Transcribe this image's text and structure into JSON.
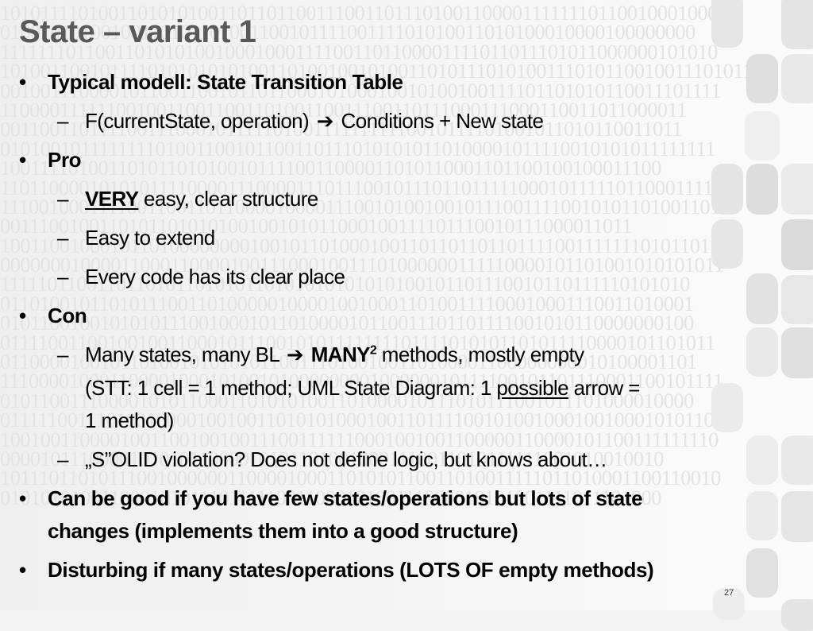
{
  "slide": {
    "title": "State – variant 1",
    "page_number": "27",
    "background_binary": [
      "1010111101001101010100110110110011100110111010011000011111110110010001000",
      "0100101010010011010110100110010111100111101010011010100010000100000000",
      "1111111011001101010100100010001111001101100001111011011101011000000101010",
      "1010011001011110101010101001101001001010011010111010100111010110010011101011",
      "0010011100001011001100101101100010100010010100100111101101010110011101111",
      "1100001111110010011001100110100110011100110111000111000110011011000011",
      "0011001101111001110001011111010011111111110010111101001011010110011011",
      "0101001011111111010011001011001101110101010110100001011110010101011111111",
      "1001111010011010110101001011110011000011010110001101100100100011100",
      "1101100001010101111000011100001110111001011101101111100010111110110001111",
      "1110010001111001100110110000100001110010100100101110011110010101101001101",
      "0011100100110101101010100100101011000100111101110010111000011011",
      "1001100100010110100000000100101101000100110110110110111100111111101011011",
      "0000000100001100011000010011100010011101000000111110000101101001010101011",
      "1111101100110110101101010110101010101010100101101110010110111110101010",
      "0110100101101011100110100000100001001000110100111100010001110011010001",
      "0101100100101010111001000101101000010110011101101111001010110000000100",
      "0111100110010010011000101110010101111111101111010101101011110000101101011",
      "0110000100101101001010101011001110100100110100001100000000010100001101",
      "1110000100011000010001010010100000000100000010111100101101110001100101111",
      "0101100111000010101100011010101001101000010111010111001011101000010000",
      "0111110011101001000010010011010101000100110111100101001000100100010101101",
      "1001001100001001100100100111001111110001001001100000110000101100111111110",
      "0000101110000101010110000101011010010001110011010111111001010010010",
      "1011101101011100100000011000010001101010110011010011111011010001100110010",
      "0101010100110001010111011111001100010100111000010101001111011101000"
    ]
  },
  "bullets": [
    {
      "level": 1,
      "text": "Typical modell: State Transition Table"
    },
    {
      "level": 2,
      "parts": [
        "F(currentState, operation)",
        "➔",
        "Conditions + New state"
      ]
    },
    {
      "level": 1,
      "text": "Pro"
    },
    {
      "level": 2,
      "emphasis": "VERY",
      "text": " easy, clear structure"
    },
    {
      "level": 2,
      "text": "Easy to extend"
    },
    {
      "level": 2,
      "text": "Every code has its clear place"
    },
    {
      "level": 1,
      "text": "Con"
    },
    {
      "level": 2,
      "parts": [
        "Many states, many BL",
        "➔",
        "MANY",
        "2",
        " methods, mostly empty"
      ]
    },
    {
      "level": 2,
      "continuation": true,
      "parts": [
        "(STT: 1 cell = 1 method; UML State Diagram: 1 ",
        "possible",
        " arrow ="
      ]
    },
    {
      "level": 2,
      "continuation": true,
      "text": "1 method)"
    },
    {
      "level": 2,
      "text": "„S”OLID violation? Does not define logic, but knows about…"
    },
    {
      "level": 1,
      "text": "Can be good if you have few states/operations but lots of state"
    },
    {
      "level": 1,
      "continuation": true,
      "text": "changes (implements them into a good structure)"
    },
    {
      "level": 1,
      "text": "Disturbing if many states/operations (LOTS OF empty methods)"
    }
  ],
  "markers": {
    "bullet": "•",
    "dash": "–"
  },
  "colors": {
    "title": "#595959",
    "body_text": "#000000",
    "background": "#f3f3f3",
    "watermark": "#e3e3e3",
    "decor_blocks": "#dcdcdc"
  }
}
